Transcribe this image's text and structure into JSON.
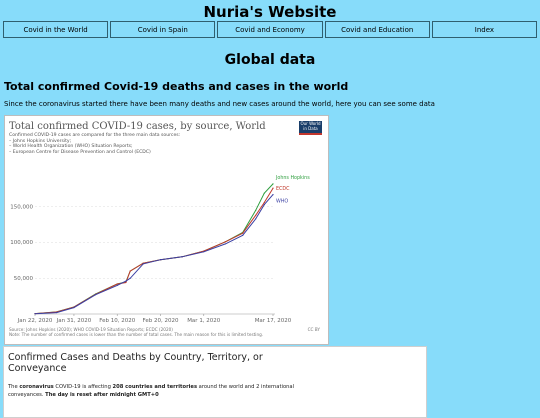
{
  "header": {
    "site_title": "Nuria's Website"
  },
  "nav": {
    "items": [
      "Covid in the World",
      "Covid in Spain",
      "Covid and Economy",
      "Covid and Education",
      "Index"
    ]
  },
  "main": {
    "section_title": "Global data",
    "sub_title": "Total confirmed Covid-19 deaths and cases in the world",
    "intro": "Since the coronavirus started there have been many deaths and new cases around the world, here you can see some data"
  },
  "chart": {
    "logo_line1": "Our World",
    "logo_line2": "in Data",
    "footer_source": "Source: Johns Hopkins (2020); WHO COVID-19 Situation Reports; ECDC (2020)",
    "footer_note": "Note: The number of confirmed cases is lower than the number of total cases. The main reason for this is limited testing.",
    "license": "CC BY"
  },
  "chart_data": {
    "type": "line",
    "title": "Total confirmed COVID-19 cases, by source, World",
    "subtitle": "Confirmed COVID-19 cases are compared for the three main data sources:\n– Johns Hopkins University;\n– World Health Organization (WHO) Situation Reports;\n– European Centre for Disease Prevention and Control (ECDC)",
    "x": [
      "2020-01-22",
      "2020-01-27",
      "2020-01-31",
      "2020-02-05",
      "2020-02-10",
      "2020-02-12",
      "2020-02-13",
      "2020-02-16",
      "2020-02-20",
      "2020-02-25",
      "2020-03-01",
      "2020-03-06",
      "2020-03-10",
      "2020-03-13",
      "2020-03-15",
      "2020-03-17"
    ],
    "x_ticks": [
      "Jan 22, 2020",
      "Jan 31, 2020",
      "Feb 10, 2020",
      "Feb 20, 2020",
      "Mar 1, 2020",
      "Mar 17, 2020"
    ],
    "y_ticks": [
      "50,000",
      "100,000",
      "150,000"
    ],
    "ylim": [
      0,
      200000
    ],
    "grid": true,
    "legend_position": "right-end-labels",
    "series": [
      {
        "name": "Johns Hopkins",
        "color": "#2e9e3e",
        "values": [
          555,
          2900,
          9800,
          28000,
          42000,
          45000,
          60000,
          71000,
          76000,
          80000,
          88000,
          101000,
          114000,
          145000,
          169000,
          182000
        ]
      },
      {
        "name": "ECDC",
        "color": "#c0392b",
        "values": [
          580,
          2800,
          9700,
          27500,
          42000,
          44000,
          60000,
          71000,
          76000,
          80000,
          88000,
          101000,
          113000,
          138000,
          156000,
          176000
        ]
      },
      {
        "name": "WHO",
        "color": "#3a3fa3",
        "values": [
          300,
          2000,
          9000,
          27000,
          40000,
          46000,
          50000,
          70000,
          76000,
          80000,
          87000,
          98000,
          110000,
          133000,
          153000,
          167000
        ]
      }
    ]
  },
  "table_section": {
    "title": "Confirmed Cases and Deaths by Country, Territory, or Conveyance",
    "desc_pre": "The ",
    "desc_b1": "coronavirus",
    "desc_mid1": " COVID-19 is affecting ",
    "desc_b2": "208 countries and territories",
    "desc_mid2": " around the world and 2 international conveyances. ",
    "desc_b3": "The day is reset after midnight GMT+0"
  }
}
